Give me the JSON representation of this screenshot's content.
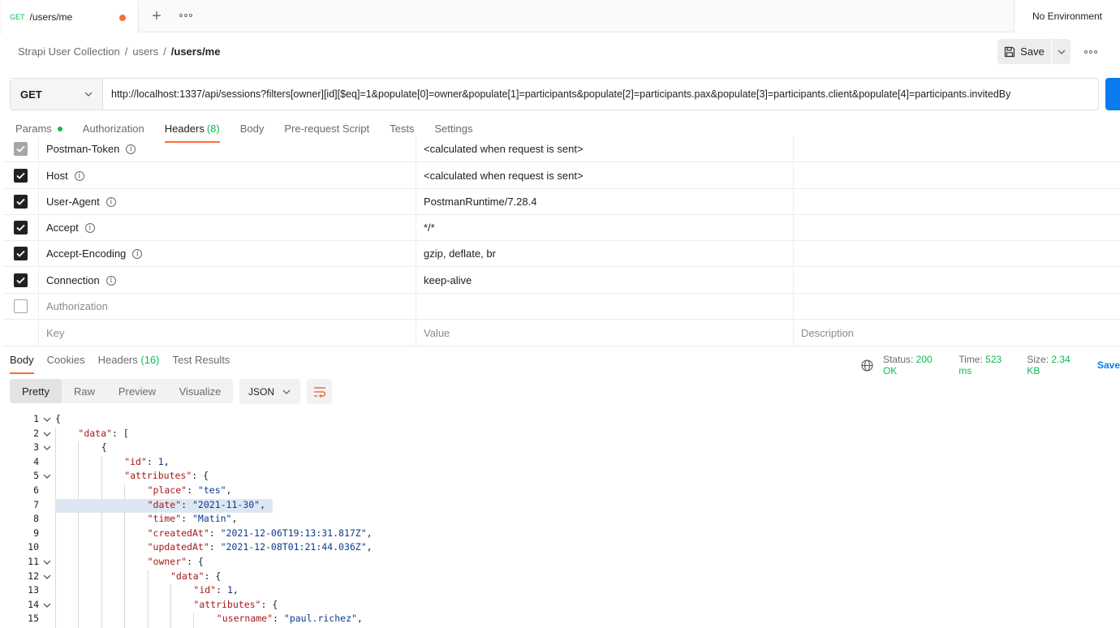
{
  "tab": {
    "method": "GET",
    "label": "/users/me"
  },
  "environment": "No Environment",
  "breadcrumb": {
    "collection": "Strapi User Collection",
    "folder": "users",
    "current": "/users/me",
    "sep": "/"
  },
  "save_label": "Save",
  "request": {
    "method": "GET",
    "url": "http://localhost:1337/api/sessions?filters[owner][id][$eq]=1&populate[0]=owner&populate[1]=participants&populate[2]=participants.pax&populate[3]=participants.client&populate[4]=participants.invitedBy"
  },
  "request_tabs": [
    {
      "label": "Params"
    },
    {
      "label": "Authorization"
    },
    {
      "label": "Headers",
      "count": "(8)"
    },
    {
      "label": "Body"
    },
    {
      "label": "Pre-request Script"
    },
    {
      "label": "Tests"
    },
    {
      "label": "Settings"
    }
  ],
  "headers": [
    {
      "key": "Postman-Token",
      "value": "<calculated when request is sent>",
      "checked": "gray"
    },
    {
      "key": "Host",
      "value": "<calculated when request is sent>",
      "checked": "yes"
    },
    {
      "key": "User-Agent",
      "value": "PostmanRuntime/7.28.4",
      "checked": "yes"
    },
    {
      "key": "Accept",
      "value": "*/*",
      "checked": "yes"
    },
    {
      "key": "Accept-Encoding",
      "value": "gzip, deflate, br",
      "checked": "yes"
    },
    {
      "key": "Connection",
      "value": "keep-alive",
      "checked": "yes"
    },
    {
      "key": "Authorization",
      "value": "",
      "checked": "no"
    }
  ],
  "header_placeholders": {
    "key": "Key",
    "value": "Value",
    "description": "Description"
  },
  "response_tabs": [
    {
      "label": "Body"
    },
    {
      "label": "Cookies"
    },
    {
      "label": "Headers",
      "count": "(16)"
    },
    {
      "label": "Test Results"
    }
  ],
  "status": {
    "status_label": "Status:",
    "status_value": "200 OK",
    "time_label": "Time:",
    "time_value": "523 ms",
    "size_label": "Size:",
    "size_value": "2.34 KB",
    "save": "Save"
  },
  "view_modes": [
    "Pretty",
    "Raw",
    "Preview",
    "Visualize"
  ],
  "format": "JSON",
  "code_lines": [
    {
      "n": "1",
      "fold": true,
      "indent": 0,
      "tokens": [
        [
          "p",
          "{"
        ]
      ]
    },
    {
      "n": "2",
      "fold": true,
      "indent": 1,
      "tokens": [
        [
          "k",
          "\"data\""
        ],
        [
          "p",
          ": ["
        ]
      ]
    },
    {
      "n": "3",
      "fold": true,
      "indent": 2,
      "tokens": [
        [
          "p",
          "{"
        ]
      ]
    },
    {
      "n": "4",
      "fold": false,
      "indent": 3,
      "tokens": [
        [
          "k",
          "\"id\""
        ],
        [
          "p",
          ": "
        ],
        [
          "n",
          "1"
        ],
        [
          "p",
          ","
        ]
      ]
    },
    {
      "n": "5",
      "fold": true,
      "indent": 3,
      "tokens": [
        [
          "k",
          "\"attributes\""
        ],
        [
          "p",
          ": {"
        ]
      ]
    },
    {
      "n": "6",
      "fold": false,
      "indent": 4,
      "tokens": [
        [
          "k",
          "\"place\""
        ],
        [
          "p",
          ": "
        ],
        [
          "s",
          "\"tes\""
        ],
        [
          "p",
          ","
        ]
      ]
    },
    {
      "n": "7",
      "fold": false,
      "indent": 4,
      "hl": true,
      "tokens": [
        [
          "k",
          "\"date\""
        ],
        [
          "p",
          ": "
        ],
        [
          "s",
          "\"2021-11-30\""
        ],
        [
          "p",
          ","
        ]
      ]
    },
    {
      "n": "8",
      "fold": false,
      "indent": 4,
      "tokens": [
        [
          "k",
          "\"time\""
        ],
        [
          "p",
          ": "
        ],
        [
          "s",
          "\"Matin\""
        ],
        [
          "p",
          ","
        ]
      ]
    },
    {
      "n": "9",
      "fold": false,
      "indent": 4,
      "tokens": [
        [
          "k",
          "\"createdAt\""
        ],
        [
          "p",
          ": "
        ],
        [
          "s",
          "\"2021-12-06T19:13:31.817Z\""
        ],
        [
          "p",
          ","
        ]
      ]
    },
    {
      "n": "10",
      "fold": false,
      "indent": 4,
      "tokens": [
        [
          "k",
          "\"updatedAt\""
        ],
        [
          "p",
          ": "
        ],
        [
          "s",
          "\"2021-12-08T01:21:44.036Z\""
        ],
        [
          "p",
          ","
        ]
      ]
    },
    {
      "n": "11",
      "fold": true,
      "indent": 4,
      "tokens": [
        [
          "k",
          "\"owner\""
        ],
        [
          "p",
          ": {"
        ]
      ]
    },
    {
      "n": "12",
      "fold": true,
      "indent": 5,
      "tokens": [
        [
          "k",
          "\"data\""
        ],
        [
          "p",
          ": {"
        ]
      ]
    },
    {
      "n": "13",
      "fold": false,
      "indent": 6,
      "tokens": [
        [
          "k",
          "\"id\""
        ],
        [
          "p",
          ": "
        ],
        [
          "n",
          "1"
        ],
        [
          "p",
          ","
        ]
      ]
    },
    {
      "n": "14",
      "fold": true,
      "indent": 6,
      "tokens": [
        [
          "k",
          "\"attributes\""
        ],
        [
          "p",
          ": {"
        ]
      ]
    },
    {
      "n": "15",
      "fold": false,
      "indent": 7,
      "tokens": [
        [
          "k",
          "\"username\""
        ],
        [
          "p",
          ": "
        ],
        [
          "s",
          "\"paul.richez\""
        ],
        [
          "p",
          ","
        ]
      ]
    }
  ]
}
